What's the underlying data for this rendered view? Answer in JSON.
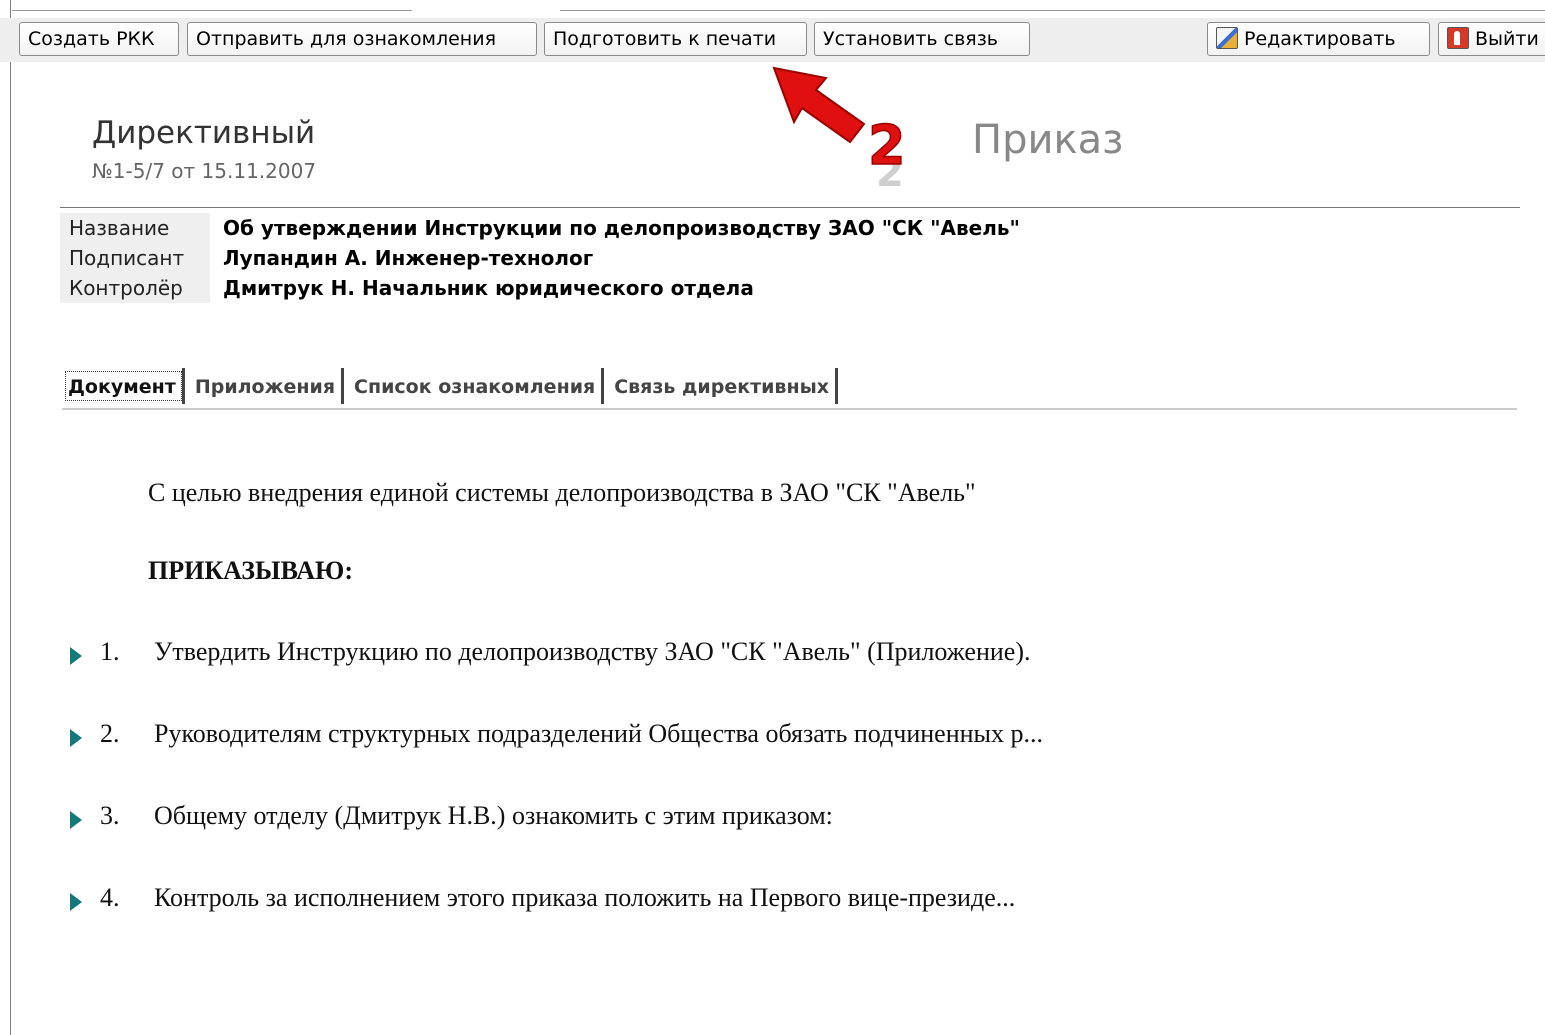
{
  "toolbar": {
    "create_rkk": "Создать РКК",
    "send_for_review": "Отправить для ознакомления",
    "prepare_print": "Подготовить к печати",
    "set_link": "Установить связь",
    "edit": "Редактировать",
    "exit": "Выйти",
    "edit_icon": "edit-icon",
    "exit_icon": "exit-icon"
  },
  "header": {
    "doc_kind": "Директивный",
    "doc_number": "№1-5/7 от 15.11.2007",
    "doc_type": "Приказ",
    "annotation_number": "2"
  },
  "properties": [
    {
      "label": "Название",
      "value": "Об утверждении Инструкции по делопроизводству ЗАО \"СК \"Авель\""
    },
    {
      "label": "Подписант",
      "value": "Лупандин А. Инженер-технолог"
    },
    {
      "label": "Контролёр",
      "value": "Дмитрук Н. Начальник юридического отдела"
    }
  ],
  "tabs": [
    {
      "label": "Документ",
      "active": true
    },
    {
      "label": "Приложения",
      "active": false
    },
    {
      "label": "Список ознакомления",
      "active": false
    },
    {
      "label": "Связь директивных",
      "active": false
    }
  ],
  "body": {
    "intro": "С целью внедрения единой системы делопроизводства в ЗАО \"СК \"Авель\"",
    "order_word": "ПРИКАЗЫВАЮ:",
    "items": [
      {
        "num": "1.",
        "text": "Утвердить Инструкцию по делопроизводству ЗАО \"СК \"Авель\" (Приложение)."
      },
      {
        "num": "2.",
        "text": "Руководителям структурных подразделений Общества обязать подчиненных р..."
      },
      {
        "num": "3.",
        "text": "Общему отделу (Дмитрук Н.В.) ознакомить с этим приказом:"
      },
      {
        "num": "4.",
        "text": "Контроль за исполнением этого приказа положить на Первого вице-президе..."
      }
    ]
  },
  "colors": {
    "annotation_arrow": "#e01010",
    "bullet": "#137a7a"
  }
}
